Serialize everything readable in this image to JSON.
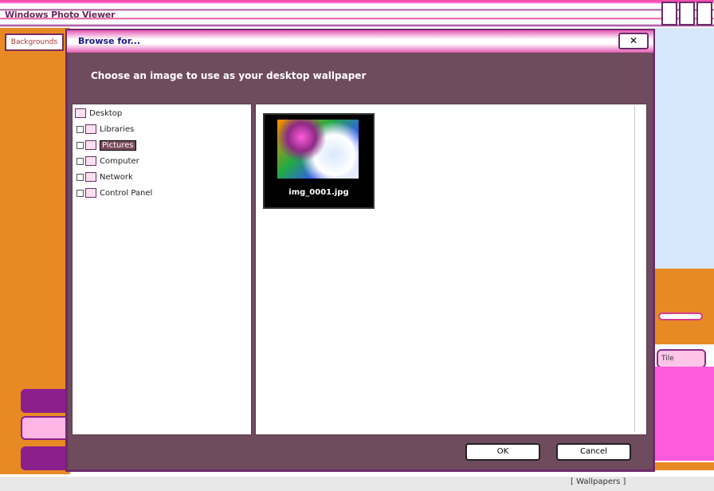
{
  "window": {
    "title": "Windows Photo Viewer",
    "status_text": "[ Wallpapers ]"
  },
  "left_panel": {
    "tab_label": "Backgrounds"
  },
  "right_panel": {
    "chip_label": "Tile"
  },
  "dialog": {
    "title": "Browse for...",
    "instruction": "Choose an image to use as your desktop wallpaper",
    "close_label": "✕",
    "tree": [
      {
        "label": "Desktop",
        "level": 0
      },
      {
        "label": "Libraries",
        "level": 1
      },
      {
        "label": "Pictures",
        "level": 1,
        "selected": true
      },
      {
        "label": "Computer",
        "level": 1
      },
      {
        "label": "Network",
        "level": 1
      },
      {
        "label": "Control Panel",
        "level": 1
      }
    ],
    "thumbnail_label": "img_0001.jpg",
    "ok_label": "OK",
    "cancel_label": "Cancel"
  },
  "colors": {
    "accent_orange": "#e88a24",
    "accent_magenta": "#ff5bdc",
    "dialog_bg": "#6f4b5e"
  }
}
